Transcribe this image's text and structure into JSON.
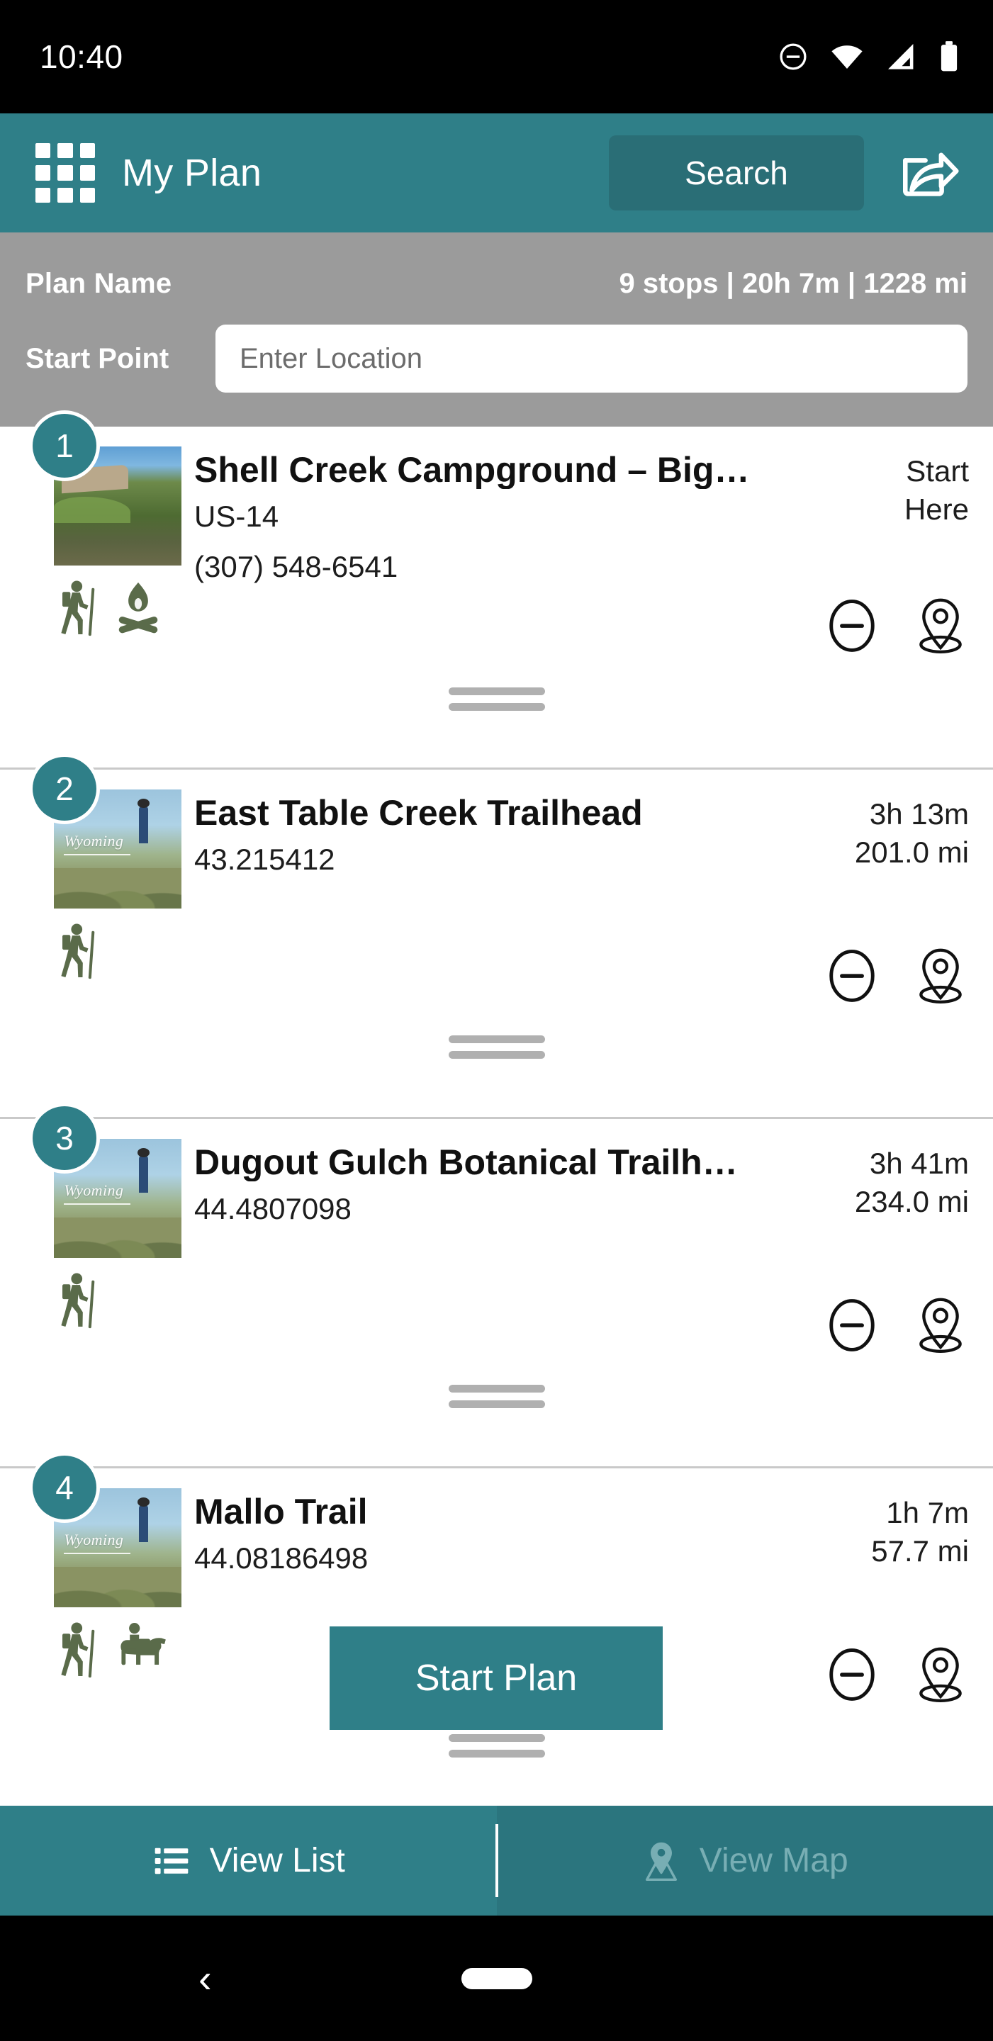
{
  "status_bar": {
    "time": "10:40",
    "icons": [
      "do-not-disturb-icon",
      "wifi-icon",
      "cellular-signal-icon",
      "battery-icon"
    ]
  },
  "app_bar": {
    "menu_icon": "grid-menu-icon",
    "title": "My Plan",
    "search_label": "Search",
    "share_icon": "share-icon",
    "background_color": "#2F7F88",
    "search_button_color": "#2A6E76"
  },
  "plan_bar": {
    "plan_name_label": "Plan Name",
    "stats": "9 stops  |  20h 7m  |  1228 mi",
    "stops_count": "9 stops",
    "total_time": "20h 7m",
    "total_distance": "1228 mi",
    "start_point_label": "Start Point",
    "start_point_value": "",
    "start_point_placeholder": "Enter Location",
    "background_color": "#9B9B9B"
  },
  "stops": [
    {
      "number": "1",
      "title": "Shell Creek Campground – Big…",
      "subtitle": "US-14",
      "subtitle2": "(307) 548-6541",
      "meta_line1": "Start",
      "meta_line2": "Here",
      "activities": [
        "hiking-icon",
        "campfire-icon"
      ],
      "thumbnail": "campground-photo"
    },
    {
      "number": "2",
      "title": "East Table Creek Trailhead",
      "subtitle": "43.215412",
      "subtitle2": "",
      "meta_line1": "3h 13m",
      "meta_line2": "201.0 mi",
      "activities": [
        "hiking-icon"
      ],
      "thumbnail": "wyoming-photo"
    },
    {
      "number": "3",
      "title": "Dugout Gulch Botanical Trailh…",
      "subtitle": "44.4807098",
      "subtitle2": "",
      "meta_line1": "3h 41m",
      "meta_line2": "234.0 mi",
      "activities": [
        "hiking-icon"
      ],
      "thumbnail": "wyoming-photo"
    },
    {
      "number": "4",
      "title": "Mallo Trail",
      "subtitle": "44.08186498",
      "subtitle2": "",
      "meta_line1": "1h 7m",
      "meta_line2": "57.7 mi",
      "activities": [
        "hiking-icon",
        "horseback-riding-icon"
      ],
      "thumbnail": "wyoming-photo"
    }
  ],
  "start_plan": {
    "label": "Start Plan",
    "color": "#2F7F88"
  },
  "bottom_nav": {
    "tabs": [
      {
        "label": "View List",
        "icon": "list-icon",
        "active": true
      },
      {
        "label": "View Map",
        "icon": "map-pin-icon",
        "active": false
      }
    ],
    "active_color": "#ffffff",
    "inactive_color": "#78AEB4"
  },
  "android_nav": {
    "back_glyph": "‹",
    "home_pill": "home-pill"
  },
  "colors": {
    "teal": "#2F7F88",
    "teal_dark": "#2A6E76",
    "gray_bar": "#9B9B9B",
    "activity_green": "#5A6B4A",
    "divider": "#c9c9c9"
  }
}
